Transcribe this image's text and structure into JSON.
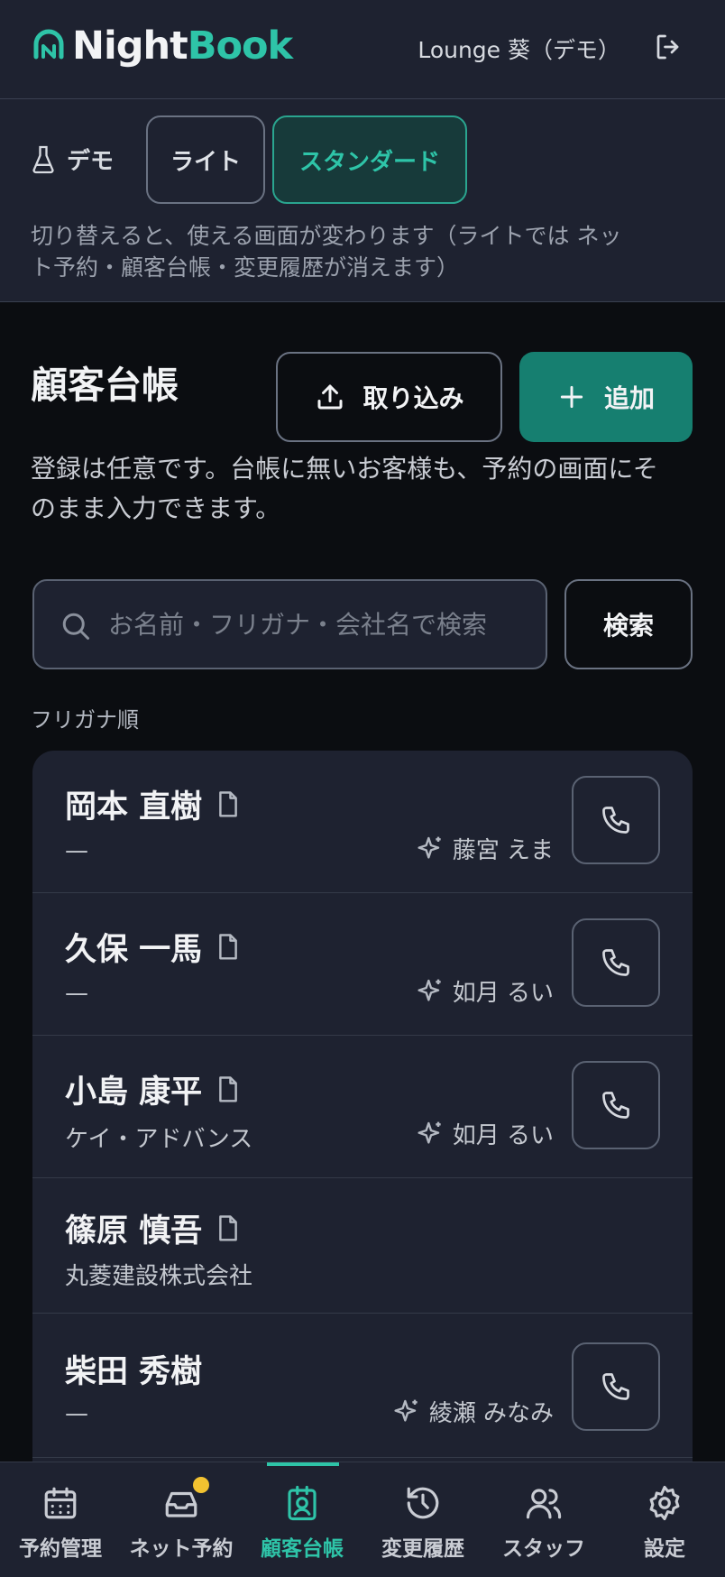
{
  "header": {
    "logo_night": "Night",
    "logo_book": "Book",
    "store_name": "Lounge 葵（デモ）"
  },
  "demo_bar": {
    "label": "デモ",
    "plans": [
      {
        "label": "ライト",
        "active": false
      },
      {
        "label": "スタンダード",
        "active": true
      }
    ],
    "note": "切り替えると、使える画面が変わります（ライトでは ネット予約・顧客台帳・変更履歴が消えます）"
  },
  "page": {
    "title": "顧客台帳",
    "import_label": "取り込み",
    "add_label": "追加",
    "description": "登録は任意です。台帳に無いお客様も、予約の画面にそのまま入力できます。"
  },
  "search": {
    "placeholder": "お名前・フリガナ・会社名で検索",
    "value": "",
    "button_label": "検索"
  },
  "sort_label": "フリガナ順",
  "customers": [
    {
      "name": "岡本 直樹",
      "sub": "—",
      "staff": "藤宮 えま",
      "has_memo": true,
      "has_phone": true
    },
    {
      "name": "久保 一馬",
      "sub": "—",
      "staff": "如月 るい",
      "has_memo": true,
      "has_phone": true
    },
    {
      "name": "小島 康平",
      "sub": "ケイ・アドバンス",
      "staff": "如月 るい",
      "has_memo": true,
      "has_phone": true
    },
    {
      "name": "篠原 慎吾",
      "sub": "丸菱建設株式会社",
      "staff": "",
      "has_memo": true,
      "has_phone": false
    },
    {
      "name": "柴田 秀樹",
      "sub": "—",
      "staff": "綾瀬 みなみ",
      "has_memo": false,
      "has_phone": true
    }
  ],
  "tabs": [
    {
      "label": "予約管理",
      "icon": "calendar-icon",
      "active": false
    },
    {
      "label": "ネット予約",
      "icon": "inbox-icon",
      "active": false,
      "badge": true
    },
    {
      "label": "顧客台帳",
      "icon": "contact-book-icon",
      "active": true
    },
    {
      "label": "変更履歴",
      "icon": "history-icon",
      "active": false
    },
    {
      "label": "スタッフ",
      "icon": "users-icon",
      "active": false
    },
    {
      "label": "設定",
      "icon": "gear-icon",
      "active": false
    }
  ],
  "colors": {
    "accent": "#2ec4a8",
    "primary_button": "#167f70",
    "badge": "#f2c230",
    "background": "#0b0d11",
    "panel": "#1e2230"
  }
}
